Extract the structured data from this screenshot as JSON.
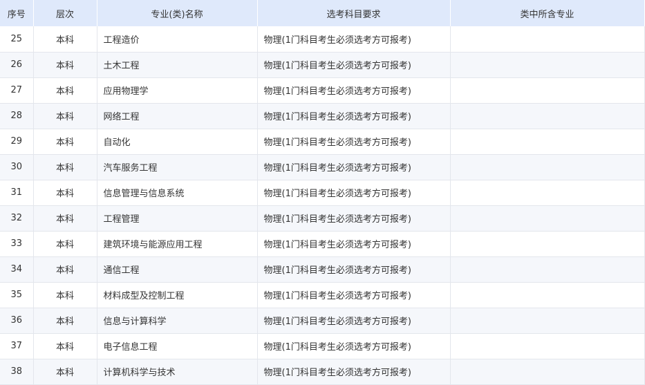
{
  "table": {
    "headers": [
      "序号",
      "层次",
      "专业(类)名称",
      "选考科目要求",
      "类中所含专业"
    ],
    "rows": [
      {
        "seq": "25",
        "level": "本科",
        "name": "工程造价",
        "requirement": "物理(1门科目考生必须选考方可报考)",
        "sub_majors": ""
      },
      {
        "seq": "26",
        "level": "本科",
        "name": "土木工程",
        "requirement": "物理(1门科目考生必须选考方可报考)",
        "sub_majors": ""
      },
      {
        "seq": "27",
        "level": "本科",
        "name": "应用物理学",
        "requirement": "物理(1门科目考生必须选考方可报考)",
        "sub_majors": ""
      },
      {
        "seq": "28",
        "level": "本科",
        "name": "网络工程",
        "requirement": "物理(1门科目考生必须选考方可报考)",
        "sub_majors": ""
      },
      {
        "seq": "29",
        "level": "本科",
        "name": "自动化",
        "requirement": "物理(1门科目考生必须选考方可报考)",
        "sub_majors": ""
      },
      {
        "seq": "30",
        "level": "本科",
        "name": "汽车服务工程",
        "requirement": "物理(1门科目考生必须选考方可报考)",
        "sub_majors": ""
      },
      {
        "seq": "31",
        "level": "本科",
        "name": "信息管理与信息系统",
        "requirement": "物理(1门科目考生必须选考方可报考)",
        "sub_majors": ""
      },
      {
        "seq": "32",
        "level": "本科",
        "name": "工程管理",
        "requirement": "物理(1门科目考生必须选考方可报考)",
        "sub_majors": ""
      },
      {
        "seq": "33",
        "level": "本科",
        "name": "建筑环境与能源应用工程",
        "requirement": "物理(1门科目考生必须选考方可报考)",
        "sub_majors": ""
      },
      {
        "seq": "34",
        "level": "本科",
        "name": "通信工程",
        "requirement": "物理(1门科目考生必须选考方可报考)",
        "sub_majors": ""
      },
      {
        "seq": "35",
        "level": "本科",
        "name": "材料成型及控制工程",
        "requirement": "物理(1门科目考生必须选考方可报考)",
        "sub_majors": ""
      },
      {
        "seq": "36",
        "level": "本科",
        "name": "信息与计算科学",
        "requirement": "物理(1门科目考生必须选考方可报考)",
        "sub_majors": ""
      },
      {
        "seq": "37",
        "level": "本科",
        "name": "电子信息工程",
        "requirement": "物理(1门科目考生必须选考方可报考)",
        "sub_majors": ""
      },
      {
        "seq": "38",
        "level": "本科",
        "name": "计算机科学与技术",
        "requirement": "物理(1门科目考生必须选考方可报考)",
        "sub_majors": ""
      }
    ]
  },
  "colors": {
    "header_bg": "#dfe9fb",
    "stripe_bg": "#f5f7fb",
    "border": "#e3e6ec",
    "text": "#333333"
  }
}
